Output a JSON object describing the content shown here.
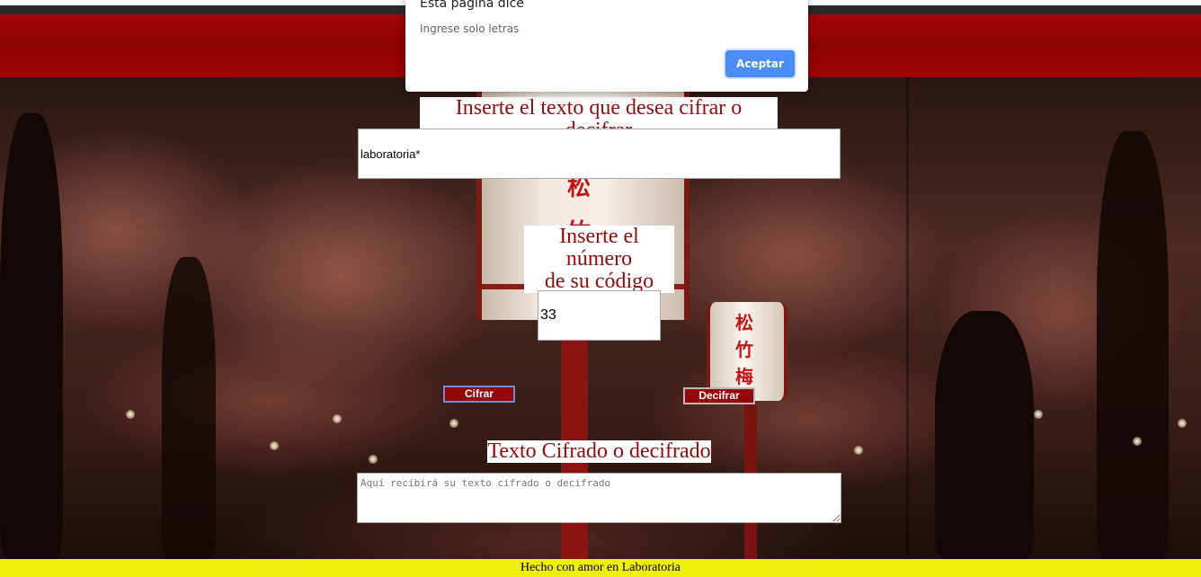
{
  "dialog": {
    "title": "Esta página dice",
    "message": "Ingrese solo letras",
    "ok_label": "Aceptar"
  },
  "form": {
    "text_label": "Inserte el texto que desea cifrar o decifrar",
    "text_value": "laboratoria*",
    "number_label_line1": "Inserte el número",
    "number_label_line2": "de su código",
    "number_value": "33",
    "cifrar_label": "Cifrar",
    "decifrar_label": "Decifrar",
    "result_label": "Texto Cifrado o decifrado",
    "result_placeholder": "Aquí recibirá su texto cifrado o decifrado"
  },
  "footer": {
    "text": "Hecho con amor en Laboratoria"
  },
  "colors": {
    "header_red": "#950606",
    "label_text": "#8c0e0e",
    "footer_yellow": "#eef007",
    "dialog_button": "#4a8df3"
  }
}
